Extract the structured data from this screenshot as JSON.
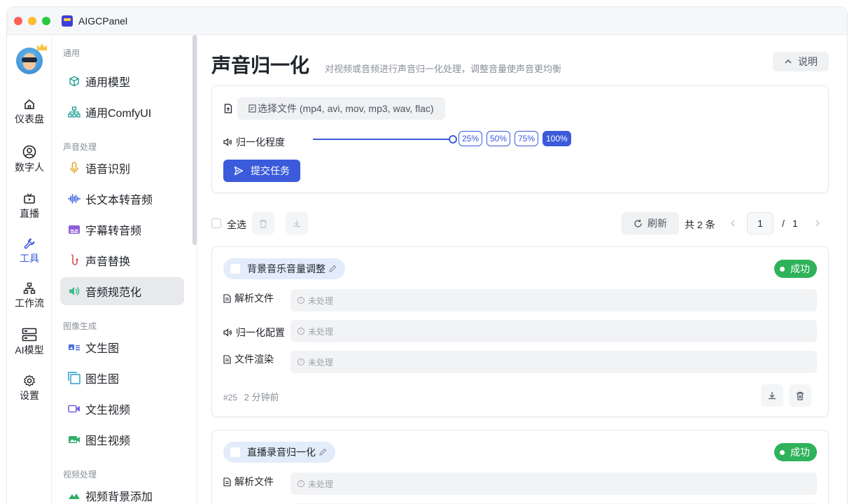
{
  "app": {
    "title": "AIGCPanel"
  },
  "rail": [
    {
      "label": "仪表盘",
      "icon": "home-icon"
    },
    {
      "label": "数字人",
      "icon": "user-circle-icon"
    },
    {
      "label": "直播",
      "icon": "tv-icon"
    },
    {
      "label": "工具",
      "icon": "wrench-icon",
      "active": true
    },
    {
      "label": "工作流",
      "icon": "workflow-icon"
    },
    {
      "label": "AI模型",
      "icon": "server-icon"
    },
    {
      "label": "设置",
      "icon": "gear-icon"
    }
  ],
  "sidebar": {
    "groups": {
      "general": "通用",
      "audio": "声音处理",
      "image": "图像生成",
      "video": "视频处理"
    },
    "items": {
      "general_model": "通用模型",
      "general_comfy": "通用ComfyUI",
      "asr": "语音识别",
      "long_text_tts": "长文本转音频",
      "subtitle_tts": "字幕转音频",
      "voice_replace": "声音替换",
      "audio_normalize": "音频规范化",
      "text_to_image": "文生图",
      "image_to_image": "图生图",
      "text_to_video": "文生视频",
      "image_to_video": "图生视频",
      "video_bg": "视频背景添加"
    }
  },
  "page": {
    "title": "声音归一化",
    "description": "对视频或音频进行声音归一化处理，调整音量使声音更均衡",
    "help_label": "说明"
  },
  "form": {
    "file_button": "选择文件 (mp4, avi, mov, mp3, wav, flac)",
    "level_label": "归一化程度",
    "level_value": 1.0,
    "level_options": [
      "25%",
      "50%",
      "75%",
      "100%"
    ],
    "selected_option": "100%",
    "submit_label": "提交任务"
  },
  "toolbar": {
    "select_all": "全选",
    "refresh": "刷新",
    "total": "共 2 条",
    "page": "1",
    "page_sep": "/",
    "page_total": "1"
  },
  "tasks": [
    {
      "name": "背景音乐音量调整",
      "status": "成功",
      "steps": [
        {
          "label": "解析文件",
          "value": "未处理"
        },
        {
          "label": "归一化配置",
          "value": "未处理"
        },
        {
          "label": "文件渲染",
          "value": "未处理"
        }
      ],
      "id": "#25",
      "time": "2 分钟前"
    },
    {
      "name": "直播录音归一化",
      "status": "成功",
      "steps": [
        {
          "label": "解析文件",
          "value": "未处理"
        }
      ]
    }
  ],
  "colors": {
    "accent": "#3b5bdb",
    "success": "#2fb25a"
  }
}
